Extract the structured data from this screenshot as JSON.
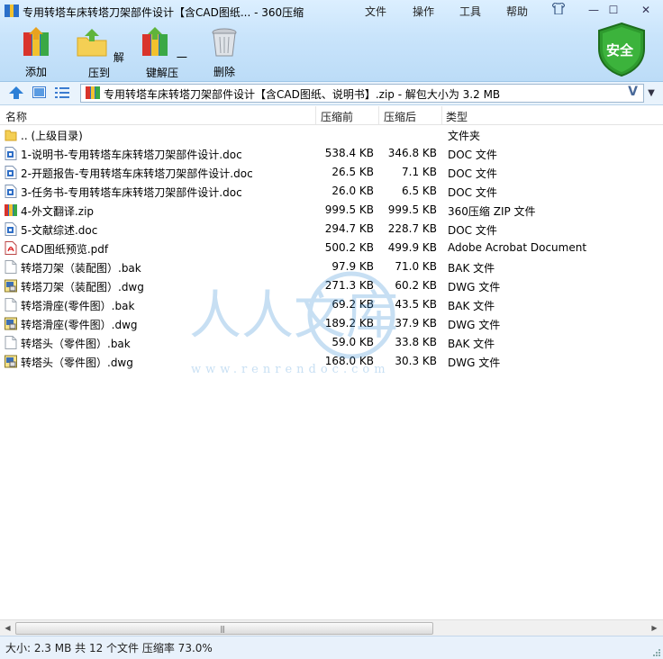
{
  "window": {
    "title": "专用转塔车床转塔刀架部件设计【含CAD图纸... - 360压缩"
  },
  "menu": {
    "file": "文件",
    "operate": "操作",
    "tools": "工具",
    "help": "帮助"
  },
  "window_controls": {
    "minimize": "—",
    "maximize": "☐",
    "close": "✕"
  },
  "toolbar": {
    "add": "添加",
    "extract": "解压到",
    "oneclick": "一键解压",
    "delete": "删除"
  },
  "security_badge": "安全",
  "address": {
    "path": "专用转塔车床转塔刀架部件设计【含CAD图纸、说明书】.zip - 解包大小为 3.2 MB",
    "v_mark": "V",
    "dropdown": "▼"
  },
  "columns": {
    "name": "名称",
    "size": "压缩前",
    "packed": "压缩后",
    "type": "类型"
  },
  "files": [
    {
      "icon": "folder-up-icon",
      "name": ".. (上级目录)",
      "size": "",
      "packed": "",
      "type": "文件夹"
    },
    {
      "icon": "doc-file-icon",
      "name": "1-说明书-专用转塔车床转塔刀架部件设计.doc",
      "size": "538.4 KB",
      "packed": "346.8 KB",
      "type": "DOC 文件"
    },
    {
      "icon": "doc-file-icon",
      "name": "2-开题报告-专用转塔车床转塔刀架部件设计.doc",
      "size": "26.5 KB",
      "packed": "7.1 KB",
      "type": "DOC 文件"
    },
    {
      "icon": "doc-file-icon",
      "name": "3-任务书-专用转塔车床转塔刀架部件设计.doc",
      "size": "26.0 KB",
      "packed": "6.5 KB",
      "type": "DOC 文件"
    },
    {
      "icon": "zip-file-icon",
      "name": "4-外文翻译.zip",
      "size": "999.5 KB",
      "packed": "999.5 KB",
      "type": "360压缩 ZIP 文件"
    },
    {
      "icon": "doc-file-icon",
      "name": "5-文献综述.doc",
      "size": "294.7 KB",
      "packed": "228.7 KB",
      "type": "DOC 文件"
    },
    {
      "icon": "pdf-file-icon",
      "name": "CAD图纸预览.pdf",
      "size": "500.2 KB",
      "packed": "499.9 KB",
      "type": "Adobe Acrobat Document"
    },
    {
      "icon": "blank-file-icon",
      "name": "转塔刀架（装配图）.bak",
      "size": "97.9 KB",
      "packed": "71.0 KB",
      "type": "BAK 文件"
    },
    {
      "icon": "dwg-file-icon",
      "name": "转塔刀架（装配图）.dwg",
      "size": "271.3 KB",
      "packed": "60.2 KB",
      "type": "DWG 文件"
    },
    {
      "icon": "blank-file-icon",
      "name": "转塔滑座(零件图）.bak",
      "size": "69.2 KB",
      "packed": "43.5 KB",
      "type": "BAK 文件"
    },
    {
      "icon": "dwg-file-icon",
      "name": "转塔滑座(零件图）.dwg",
      "size": "189.2 KB",
      "packed": "37.9 KB",
      "type": "DWG 文件"
    },
    {
      "icon": "blank-file-icon",
      "name": "转塔头（零件图）.bak",
      "size": "59.0 KB",
      "packed": "33.8 KB",
      "type": "BAK 文件"
    },
    {
      "icon": "dwg-file-icon",
      "name": "转塔头（零件图）.dwg",
      "size": "168.0 KB",
      "packed": "30.3 KB",
      "type": "DWG 文件"
    }
  ],
  "watermark": {
    "text": "人人文库",
    "url": "www.renrendoc.com"
  },
  "scrollbar": {
    "left": "◀",
    "right": "▶",
    "grip": "|||"
  },
  "status": {
    "text": "大小: 2.3 MB 共 12 个文件 压缩率 73.0%"
  },
  "colors": {
    "chrome": "#c9e4fb",
    "status": "#e8f1fb",
    "shield": "#2e9a2e",
    "watermark": "#3a8fd6"
  }
}
